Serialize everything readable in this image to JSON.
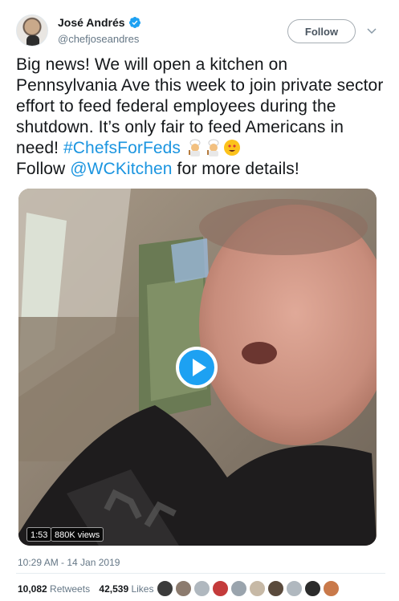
{
  "user": {
    "name": "José Andrés",
    "handle": "@chefjoseandres",
    "follow_label": "Follow"
  },
  "tweet": {
    "text_parts": [
      "Big news! We will open a kitchen on Pennsylvania Ave this week to join private sector effort to feed federal employees during the shutdown. It’s only fair to feed Americans in need! ",
      "#ChefsForFeds",
      "Follow ",
      "@WCKitchen",
      " for more details!"
    ],
    "emojis": [
      "cook-emoji",
      "cook-emoji",
      "smiling-face-emoji"
    ]
  },
  "video": {
    "duration": "1:53",
    "views": "880K views"
  },
  "timestamp": "10:29 AM - 14 Jan 2019",
  "stats": {
    "retweets_count": "10,082",
    "retweets_label": "Retweets",
    "likes_count": "42,539",
    "likes_label": "Likes"
  },
  "colors": {
    "link": "#1b95e0",
    "verified": "#1da1f2",
    "muted": "#657786"
  },
  "liker_avatars": [
    "#3b3b3b",
    "#8c7b6e",
    "#b0b8bf",
    "#c43b3b",
    "#9aa4ad",
    "#c7b9a6",
    "#5a4a3c",
    "#b0b8bf",
    "#2b2b2b",
    "#c9794a"
  ]
}
